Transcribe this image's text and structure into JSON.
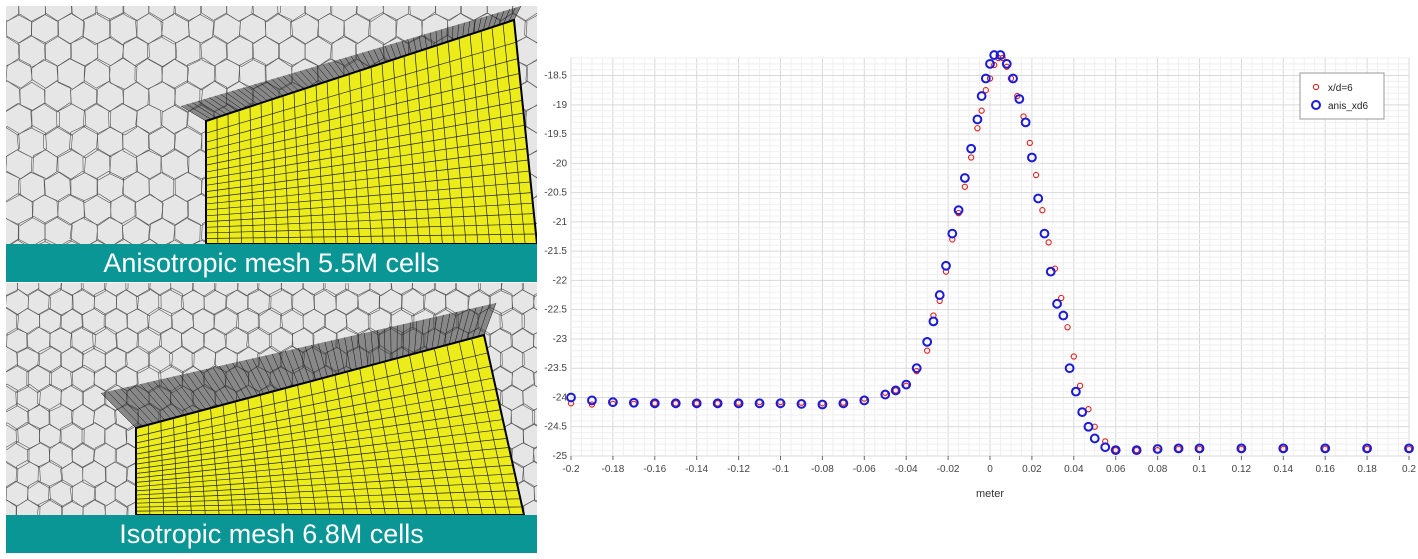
{
  "panels": [
    {
      "caption": "Anisotropic mesh 5.5M cells"
    },
    {
      "caption": "Isotropic mesh 6.8M cells"
    }
  ],
  "colors": {
    "caption_bg": "#0b9696",
    "surface": "#ecec1a",
    "series_red": "#e0201c",
    "series_blue": "#1a1ad8"
  },
  "chart_data": {
    "type": "scatter",
    "title": "",
    "xlabel": "meter",
    "ylabel": "",
    "xlim": [
      -0.2,
      0.2
    ],
    "ylim": [
      -25.0,
      -18.2
    ],
    "grid": true,
    "legend": "top-right",
    "x_ticks": [
      "-0.2",
      "-0.18",
      "-0.16",
      "-0.14",
      "-0.12",
      "-0.1",
      "-0.08",
      "-0.06",
      "-0.04",
      "-0.02",
      "0",
      "0.02",
      "0.04",
      "0.06",
      "0.08",
      "0.1",
      "0.12",
      "0.14",
      "0.16",
      "0.18",
      "0.2"
    ],
    "y_ticks": [
      "-18.5",
      "-19",
      "-19.5",
      "-20",
      "-20.5",
      "-21",
      "-21.5",
      "-22",
      "-22.5",
      "-23",
      "-23.5",
      "-24",
      "-24.5",
      "-25"
    ],
    "series": [
      {
        "name": "x/d=6",
        "marker": "small-circle",
        "color": "#e0201c",
        "points": [
          [
            -0.2,
            -24.1
          ],
          [
            -0.19,
            -24.12
          ],
          [
            -0.18,
            -24.11
          ],
          [
            -0.17,
            -24.11
          ],
          [
            -0.16,
            -24.1
          ],
          [
            -0.15,
            -24.1
          ],
          [
            -0.14,
            -24.1
          ],
          [
            -0.13,
            -24.1
          ],
          [
            -0.12,
            -24.09
          ],
          [
            -0.11,
            -24.08
          ],
          [
            -0.1,
            -24.08
          ],
          [
            -0.09,
            -24.09
          ],
          [
            -0.08,
            -24.1
          ],
          [
            -0.07,
            -24.09
          ],
          [
            -0.06,
            -24.02
          ],
          [
            -0.05,
            -23.92
          ],
          [
            -0.045,
            -23.88
          ],
          [
            -0.04,
            -23.8
          ],
          [
            -0.035,
            -23.55
          ],
          [
            -0.03,
            -23.2
          ],
          [
            -0.027,
            -22.6
          ],
          [
            -0.024,
            -22.35
          ],
          [
            -0.021,
            -21.85
          ],
          [
            -0.018,
            -21.3
          ],
          [
            -0.015,
            -20.85
          ],
          [
            -0.012,
            -20.4
          ],
          [
            -0.009,
            -19.9
          ],
          [
            -0.006,
            -19.4
          ],
          [
            -0.004,
            -19.1
          ],
          [
            -0.002,
            -18.75
          ],
          [
            0.0,
            -18.55
          ],
          [
            0.002,
            -18.32
          ],
          [
            0.004,
            -18.2
          ],
          [
            0.006,
            -18.2
          ],
          [
            0.008,
            -18.35
          ],
          [
            0.01,
            -18.55
          ],
          [
            0.013,
            -18.85
          ],
          [
            0.016,
            -19.2
          ],
          [
            0.019,
            -19.65
          ],
          [
            0.022,
            -20.2
          ],
          [
            0.025,
            -20.8
          ],
          [
            0.028,
            -21.35
          ],
          [
            0.031,
            -21.8
          ],
          [
            0.034,
            -22.3
          ],
          [
            0.037,
            -22.8
          ],
          [
            0.04,
            -23.3
          ],
          [
            0.043,
            -23.8
          ],
          [
            0.047,
            -24.2
          ],
          [
            0.05,
            -24.5
          ],
          [
            0.055,
            -24.75
          ],
          [
            0.06,
            -24.9
          ],
          [
            0.07,
            -24.9
          ],
          [
            0.08,
            -24.9
          ],
          [
            0.09,
            -24.88
          ],
          [
            0.1,
            -24.88
          ],
          [
            0.12,
            -24.88
          ],
          [
            0.14,
            -24.88
          ],
          [
            0.16,
            -24.88
          ],
          [
            0.18,
            -24.88
          ],
          [
            0.2,
            -24.88
          ]
        ]
      },
      {
        "name": "anis_xd6",
        "marker": "circle",
        "color": "#1a1ad8",
        "points": [
          [
            -0.2,
            -24.0
          ],
          [
            -0.19,
            -24.05
          ],
          [
            -0.18,
            -24.08
          ],
          [
            -0.17,
            -24.09
          ],
          [
            -0.16,
            -24.1
          ],
          [
            -0.15,
            -24.1
          ],
          [
            -0.14,
            -24.1
          ],
          [
            -0.13,
            -24.1
          ],
          [
            -0.12,
            -24.1
          ],
          [
            -0.11,
            -24.1
          ],
          [
            -0.1,
            -24.1
          ],
          [
            -0.09,
            -24.11
          ],
          [
            -0.08,
            -24.12
          ],
          [
            -0.07,
            -24.1
          ],
          [
            -0.06,
            -24.05
          ],
          [
            -0.05,
            -23.95
          ],
          [
            -0.045,
            -23.88
          ],
          [
            -0.04,
            -23.78
          ],
          [
            -0.035,
            -23.5
          ],
          [
            -0.03,
            -23.05
          ],
          [
            -0.027,
            -22.7
          ],
          [
            -0.024,
            -22.25
          ],
          [
            -0.021,
            -21.75
          ],
          [
            -0.018,
            -21.2
          ],
          [
            -0.015,
            -20.8
          ],
          [
            -0.012,
            -20.25
          ],
          [
            -0.009,
            -19.75
          ],
          [
            -0.006,
            -19.25
          ],
          [
            -0.004,
            -18.85
          ],
          [
            -0.002,
            -18.55
          ],
          [
            0.0,
            -18.3
          ],
          [
            0.002,
            -18.15
          ],
          [
            0.005,
            -18.15
          ],
          [
            0.008,
            -18.3
          ],
          [
            0.011,
            -18.55
          ],
          [
            0.014,
            -18.9
          ],
          [
            0.017,
            -19.3
          ],
          [
            0.02,
            -19.9
          ],
          [
            0.023,
            -20.6
          ],
          [
            0.026,
            -21.2
          ],
          [
            0.029,
            -21.85
          ],
          [
            0.032,
            -22.4
          ],
          [
            0.035,
            -22.6
          ],
          [
            0.038,
            -23.5
          ],
          [
            0.041,
            -23.9
          ],
          [
            0.044,
            -24.25
          ],
          [
            0.047,
            -24.5
          ],
          [
            0.05,
            -24.7
          ],
          [
            0.055,
            -24.85
          ],
          [
            0.06,
            -24.9
          ],
          [
            0.07,
            -24.9
          ],
          [
            0.08,
            -24.88
          ],
          [
            0.09,
            -24.87
          ],
          [
            0.1,
            -24.87
          ],
          [
            0.12,
            -24.87
          ],
          [
            0.14,
            -24.87
          ],
          [
            0.16,
            -24.87
          ],
          [
            0.18,
            -24.87
          ],
          [
            0.2,
            -24.87
          ]
        ]
      }
    ]
  }
}
